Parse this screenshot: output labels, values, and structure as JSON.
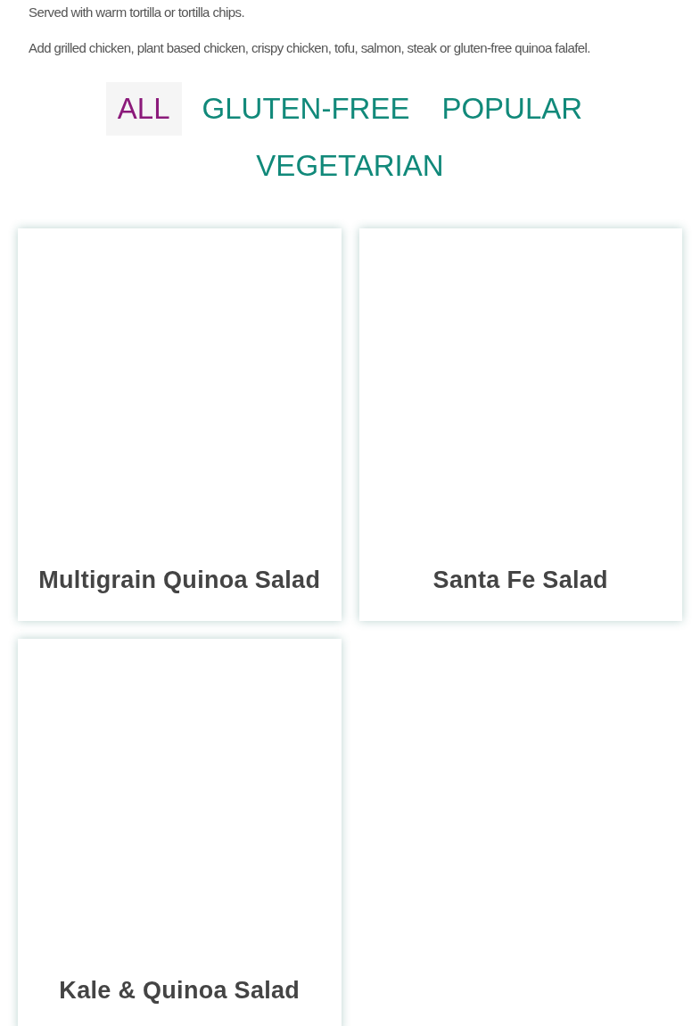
{
  "description": [
    "Served with warm tortilla or tortilla chips.",
    "Add grilled chicken, plant based chicken, crispy chicken, tofu, salmon, steak or gluten-free quinoa falafel."
  ],
  "filters": [
    {
      "label": "ALL",
      "selected": true
    },
    {
      "label": "GLUTEN-FREE",
      "selected": false
    },
    {
      "label": "POPULAR",
      "selected": false
    },
    {
      "label": "VEGETARIAN",
      "selected": false
    }
  ],
  "items": [
    {
      "name": "Multigrain Quinoa Salad"
    },
    {
      "name": "Santa Fe Salad"
    },
    {
      "name": "Kale & Quinoa Salad"
    }
  ]
}
